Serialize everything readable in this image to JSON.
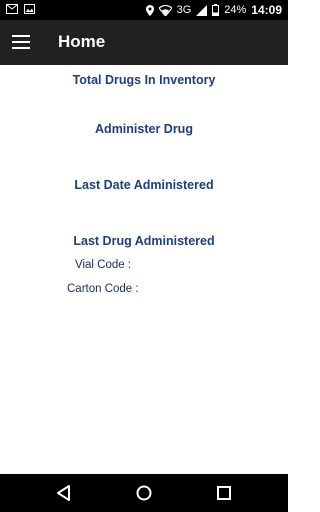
{
  "status_bar": {
    "network": "3G",
    "battery": "24%",
    "time": "14:09"
  },
  "app_bar": {
    "title": "Home"
  },
  "content": {
    "total_drugs": "Total Drugs In Inventory",
    "administer": "Administer Drug",
    "last_date": "Last Date Administered",
    "last_drug": "Last Drug Administered",
    "vial_code_label": "Vial Code :",
    "carton_code_label": "Carton Code :"
  },
  "colors": {
    "heading": "#1f3f7a",
    "appbar": "#212121"
  },
  "icons": {
    "status_left": [
      "gmail-icon",
      "image-icon"
    ],
    "status_right": [
      "location-icon",
      "wifi-icon",
      "signal-icon",
      "battery-icon"
    ],
    "app_bar": [
      "menu-icon"
    ],
    "nav": [
      "back-icon",
      "home-icon",
      "recents-icon"
    ]
  }
}
